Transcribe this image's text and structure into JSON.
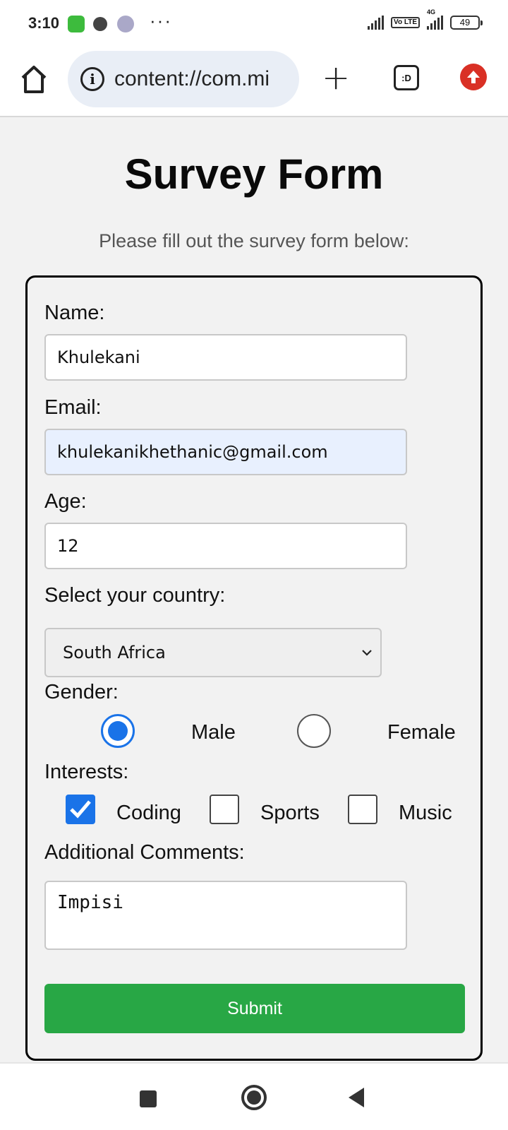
{
  "status_bar": {
    "time": "3:10",
    "battery": "49",
    "network": "4G",
    "volte": "Vo LTE"
  },
  "browser": {
    "url": "content://com.mi",
    "tabs_label": ":D",
    "icons": {
      "home": "home-icon",
      "info": "info-icon",
      "new_tab": "plus-icon",
      "tabs": "tabs-icon",
      "update": "update-arrow-icon"
    }
  },
  "page": {
    "title": "Survey Form",
    "subtitle": "Please fill out the survey form below:"
  },
  "form": {
    "name": {
      "label": "Name:",
      "value": "Khulekani"
    },
    "email": {
      "label": "Email:",
      "value": "khulekanikhethanic@gmail.com"
    },
    "age": {
      "label": "Age:",
      "value": "12"
    },
    "country": {
      "label": "Select your country:",
      "selected": "South Africa"
    },
    "gender": {
      "label": "Gender:",
      "options": [
        {
          "label": "Male",
          "checked": true
        },
        {
          "label": "Female",
          "checked": false
        }
      ]
    },
    "interests": {
      "label": "Interests:",
      "options": [
        {
          "label": "Coding",
          "checked": true
        },
        {
          "label": "Sports",
          "checked": false
        },
        {
          "label": "Music",
          "checked": false
        }
      ]
    },
    "comments": {
      "label": "Additional Comments:",
      "value": "Impisi"
    },
    "submit_label": "Submit"
  },
  "colors": {
    "accent": "#1a73e8",
    "submit": "#28a745",
    "update_badge": "#d93025"
  }
}
